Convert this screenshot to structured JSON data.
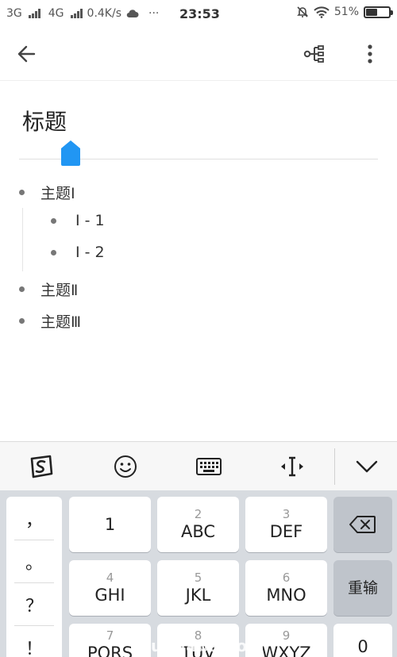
{
  "status_bar": {
    "net1": "3G",
    "net2": "4G",
    "speed": "0.4K/s",
    "dots": "···",
    "time": "23:53",
    "battery_pct": "51%",
    "battery_level": 0.51
  },
  "app_bar": {
    "back_icon": "arrow-left-icon",
    "mindmap_icon": "mindmap-icon",
    "more_icon": "more-vertical-icon"
  },
  "document": {
    "title": "标题",
    "items": [
      {
        "text": "主题Ⅰ",
        "level": 0
      },
      {
        "text": "Ⅰ - 1",
        "level": 1
      },
      {
        "text": "Ⅰ - 2",
        "level": 1
      },
      {
        "text": "主题Ⅱ",
        "level": 0
      },
      {
        "text": "主题Ⅲ",
        "level": 0
      }
    ]
  },
  "keyboard_toolbar": {
    "icons": [
      "sogou-logo-icon",
      "emoji-icon",
      "keyboard-icon",
      "cursor-move-icon",
      "collapse-chevron-icon"
    ]
  },
  "keyboard": {
    "punctuation": [
      "，",
      "。",
      "？",
      "！"
    ],
    "keys": [
      {
        "num": "",
        "label": "1"
      },
      {
        "num": "2",
        "label": "ABC"
      },
      {
        "num": "3",
        "label": "DEF"
      },
      {
        "num": "4",
        "label": "GHI"
      },
      {
        "num": "5",
        "label": "JKL"
      },
      {
        "num": "6",
        "label": "MNO"
      },
      {
        "num": "7",
        "label": "PQRS"
      },
      {
        "num": "8",
        "label": "TUV"
      },
      {
        "num": "9",
        "label": "WXYZ"
      }
    ],
    "backspace_icon": "backspace-icon",
    "reenter_label": "重输",
    "zero_label": "0"
  },
  "watermark": "tuhuaba.com"
}
